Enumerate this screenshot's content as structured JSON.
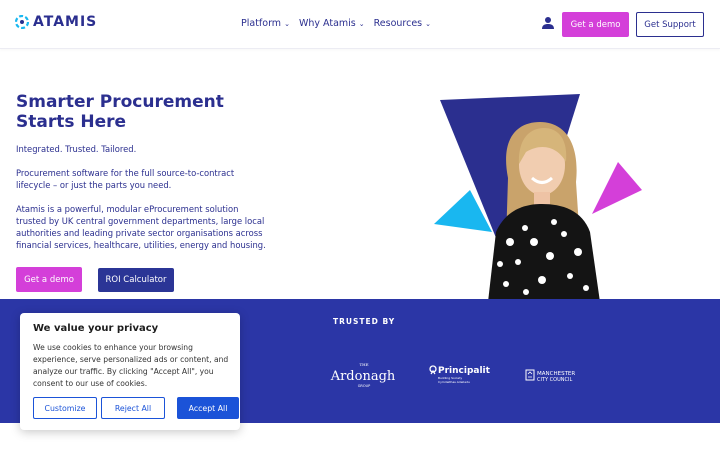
{
  "header": {
    "logo_text": "ATAMIS",
    "nav": [
      {
        "label": "Platform",
        "icon": "chevron-down-icon"
      },
      {
        "label": "Why Atamis",
        "icon": "chevron-down-icon"
      },
      {
        "label": "Resources",
        "icon": "chevron-down-icon"
      }
    ],
    "account_icon": "user-icon",
    "demo_label": "Get a demo",
    "support_label": "Get Support"
  },
  "hero": {
    "title": "Smarter Procurement Starts Here",
    "paragraphs": [
      "Integrated. Trusted. Tailored.",
      "Procurement software for the full source-to-contract lifecycle – or just the parts you need.",
      "Atamis is a powerful, modular eProcurement solution trusted by UK central government departments, large local authorities and leading private sector organisations across financial services, healthcare, utilities, energy and housing."
    ],
    "demo_label": "Get a demo",
    "roi_label": "ROI Calculator"
  },
  "trusted": {
    "title": "TRUSTED BY",
    "logos": [
      {
        "name": "The Ardonagh Group",
        "top": "THE",
        "main": "Ardonagh",
        "sub": "GROUP"
      },
      {
        "name": "Principality",
        "main": "Principality",
        "sub1": "Building Society",
        "sub2": "Cymdeithas Adeiladu"
      },
      {
        "name": "Manchester City Council",
        "line1": "MANCHESTER",
        "line2": "CITY COUNCIL"
      }
    ]
  },
  "cookie": {
    "title": "We value your privacy",
    "text": "We use cookies to enhance your browsing experience, serve personalized ads or content, and analyze our traffic. By clicking \"Accept All\", you consent to our use of cookies.",
    "customize_label": "Customize",
    "reject_label": "Reject All",
    "accept_label": "Accept All"
  },
  "colors": {
    "brand_navy": "#2b2f8f",
    "brand_magenta": "#d43fd9",
    "band_blue": "#2b36a6",
    "cookie_blue": "#1b53d8",
    "accent_cyan": "#19b7f0"
  }
}
